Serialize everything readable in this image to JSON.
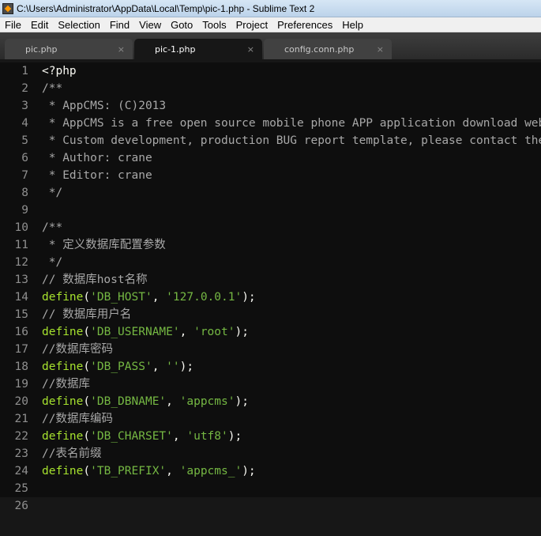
{
  "window": {
    "title": "C:\\Users\\Administrator\\AppData\\Local\\Temp\\pic-1.php - Sublime Text 2",
    "icon": "sublime-text-icon"
  },
  "menu": [
    "File",
    "Edit",
    "Selection",
    "Find",
    "View",
    "Goto",
    "Tools",
    "Project",
    "Preferences",
    "Help"
  ],
  "tabs": [
    {
      "label": "pic.php",
      "close": "×",
      "active": false
    },
    {
      "label": "pic-1.php",
      "close": "×",
      "active": true
    },
    {
      "label": "config.conn.php",
      "close": "×",
      "active": false
    }
  ],
  "colors": {
    "background": "#171717",
    "comment": "#a8a8a8",
    "keyword": "#a6e22e",
    "string": "#75b843",
    "text": "#f8f8f2",
    "line_number": "#8f8f8f"
  },
  "lines": [
    {
      "n": "1",
      "parts": [
        [
          "plain",
          "<?php"
        ]
      ]
    },
    {
      "n": "2",
      "parts": [
        [
          "com",
          "/**"
        ]
      ]
    },
    {
      "n": "3",
      "parts": [
        [
          "com",
          " * AppCMS: (C)2013"
        ]
      ]
    },
    {
      "n": "4",
      "parts": [
        [
          "com",
          " * AppCMS is a free open source mobile phone APP application download website"
        ]
      ]
    },
    {
      "n": "5",
      "parts": [
        [
          "com",
          " * Custom development, production BUG report template, please contact the author"
        ]
      ]
    },
    {
      "n": "6",
      "parts": [
        [
          "com",
          " * Author: crane"
        ]
      ]
    },
    {
      "n": "7",
      "parts": [
        [
          "com",
          " * Editor: crane"
        ]
      ]
    },
    {
      "n": "8",
      "parts": [
        [
          "com",
          " */"
        ]
      ]
    },
    {
      "n": "9",
      "parts": []
    },
    {
      "n": "10",
      "parts": [
        [
          "com",
          "/**"
        ]
      ]
    },
    {
      "n": "11",
      "parts": [
        [
          "com",
          " * 定义数据库配置参数"
        ]
      ]
    },
    {
      "n": "12",
      "parts": [
        [
          "com",
          " */"
        ]
      ]
    },
    {
      "n": "13",
      "parts": [
        [
          "com",
          "// 数据库host名称"
        ]
      ]
    },
    {
      "n": "14",
      "parts": [
        [
          "kw",
          "define"
        ],
        [
          "plain",
          "("
        ],
        [
          "str",
          "'DB_HOST'"
        ],
        [
          "plain",
          ", "
        ],
        [
          "str",
          "'127.0.0.1'"
        ],
        [
          "plain",
          ");"
        ]
      ]
    },
    {
      "n": "15",
      "parts": [
        [
          "com",
          "// 数据库用户名"
        ]
      ]
    },
    {
      "n": "16",
      "parts": [
        [
          "kw",
          "define"
        ],
        [
          "plain",
          "("
        ],
        [
          "str",
          "'DB_USERNAME'"
        ],
        [
          "plain",
          ", "
        ],
        [
          "str",
          "'root'"
        ],
        [
          "plain",
          ");"
        ]
      ]
    },
    {
      "n": "17",
      "parts": [
        [
          "com",
          "//数据库密码"
        ]
      ]
    },
    {
      "n": "18",
      "parts": [
        [
          "kw",
          "define"
        ],
        [
          "plain",
          "("
        ],
        [
          "str",
          "'DB_PASS'"
        ],
        [
          "plain",
          ", "
        ],
        [
          "str",
          "''"
        ],
        [
          "plain",
          ");"
        ]
      ]
    },
    {
      "n": "19",
      "parts": [
        [
          "com",
          "//数据库"
        ]
      ]
    },
    {
      "n": "20",
      "parts": [
        [
          "kw",
          "define"
        ],
        [
          "plain",
          "("
        ],
        [
          "str",
          "'DB_DBNAME'"
        ],
        [
          "plain",
          ", "
        ],
        [
          "str",
          "'appcms'"
        ],
        [
          "plain",
          ");"
        ]
      ]
    },
    {
      "n": "21",
      "parts": [
        [
          "com",
          "//数据库编码"
        ]
      ]
    },
    {
      "n": "22",
      "parts": [
        [
          "kw",
          "define"
        ],
        [
          "plain",
          "("
        ],
        [
          "str",
          "'DB_CHARSET'"
        ],
        [
          "plain",
          ", "
        ],
        [
          "str",
          "'utf8'"
        ],
        [
          "plain",
          ");"
        ]
      ]
    },
    {
      "n": "23",
      "parts": [
        [
          "com",
          "//表名前缀"
        ]
      ]
    },
    {
      "n": "24",
      "parts": [
        [
          "kw",
          "define"
        ],
        [
          "plain",
          "("
        ],
        [
          "str",
          "'TB_PREFIX'"
        ],
        [
          "plain",
          ", "
        ],
        [
          "str",
          "'appcms_'"
        ],
        [
          "plain",
          ");"
        ]
      ]
    },
    {
      "n": "25",
      "parts": []
    },
    {
      "n": "26",
      "parts": []
    }
  ]
}
